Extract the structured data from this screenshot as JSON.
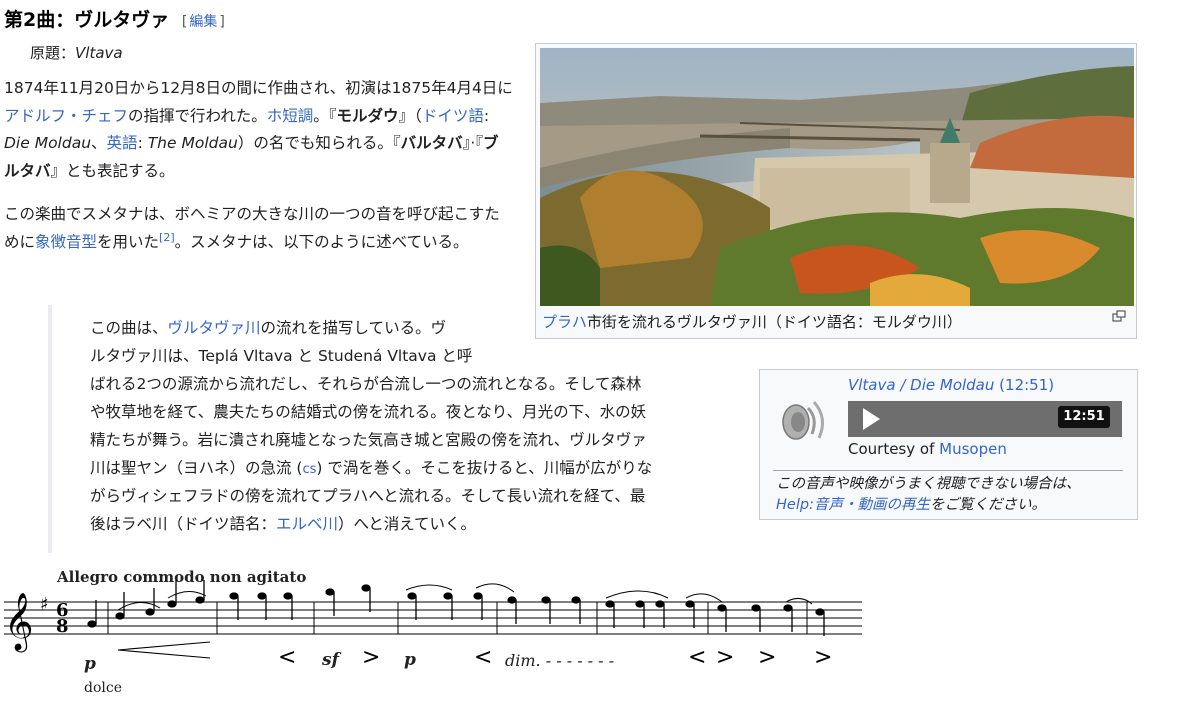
{
  "section": {
    "title": "第2曲：ヴルタヴァ",
    "edit_open": "[",
    "edit_label": "編集",
    "edit_close": "]"
  },
  "original_title": {
    "label": "原題：",
    "value": "Vltava"
  },
  "paragraph1": {
    "t1": "1874年11月20日から12月8日の間に作曲され、初演は1875年4月4日に",
    "link_conductor": "アドルフ・チェフ",
    "t2": "の指揮で行われた。",
    "link_key": "ホ短調",
    "t3": "。『",
    "b_moldau": "モルダウ",
    "t4": "』（",
    "link_german": "ドイツ語",
    "t5": ": ",
    "i_die_moldau": "Die Moldau",
    "t6": "、",
    "link_english": "英語",
    "t7": ": ",
    "i_the_moldau": "The Moldau",
    "t8": "）の名でも知られる。『",
    "b_vltava1": "バルタバ",
    "t9": "』·『",
    "b_vltava2": "ブルタバ",
    "t10": "』とも表記する。"
  },
  "paragraph2": {
    "t1": "この楽曲でスメタナは、ボヘミアの大きな川の一つの音を呼び起こすために",
    "link_motif": "象徴音型",
    "t2": "を用いた",
    "ref": "[2]",
    "t3": "。スメタナは、以下のように述べている。"
  },
  "quote": {
    "l1a": "この曲は、",
    "l1_link": "ヴルタヴァ川",
    "l1b": "の流れを描写している。ヴ",
    "l2": "ルタヴァ川は、Teplá Vltava と Studená Vltava と呼",
    "l3": "ばれる2つの源流から流れだし、それらが合流し一つの流れとなる。そして森林",
    "l4": "や牧草地を経て、農夫たちの結婚式の傍を流れる。夜となり、月光の下、水の妖",
    "l5": "精たちが舞う。岩に潰され廃墟となった気高き城と宮殿の傍を流れ、ヴルタヴァ",
    "l6a": "川は聖ヤン（ヨハネ）の急流 (",
    "l6_link": "cs",
    "l6b": ") で渦を巻く。そこを抜けると、川幅が広がりな",
    "l7": "がらヴィシェフラドの傍を流れてプラハへと流れる。そして長い流れを経て、最",
    "l8a": "後はラベ川（ドイツ語名：",
    "l8_link": "エルベ川",
    "l8b": "）へと消えていく。"
  },
  "image": {
    "caption_link": "プラハ",
    "caption_text": "市街を流れるヴルタヴァ川（ドイツ語名：モルダウ川）",
    "icon": "magnify-icon"
  },
  "audio": {
    "title_link": "Vltava / Die Moldau",
    "duration": "(12:51)",
    "time": "12:51",
    "courtesy_label": "Courtesy of ",
    "courtesy_link": "Musopen",
    "note1": "この音声や映像がうまく視聴できない場合は、",
    "note_link": "Help:音声・動画の再生",
    "note2": "をご覧ください。",
    "icon": "speaker-icon"
  },
  "score": {
    "tempo": "Allegro commodo non agitato",
    "dolce": "dolce",
    "p1": "p",
    "sf": "sf",
    "p2": "p",
    "dim": "dim."
  }
}
